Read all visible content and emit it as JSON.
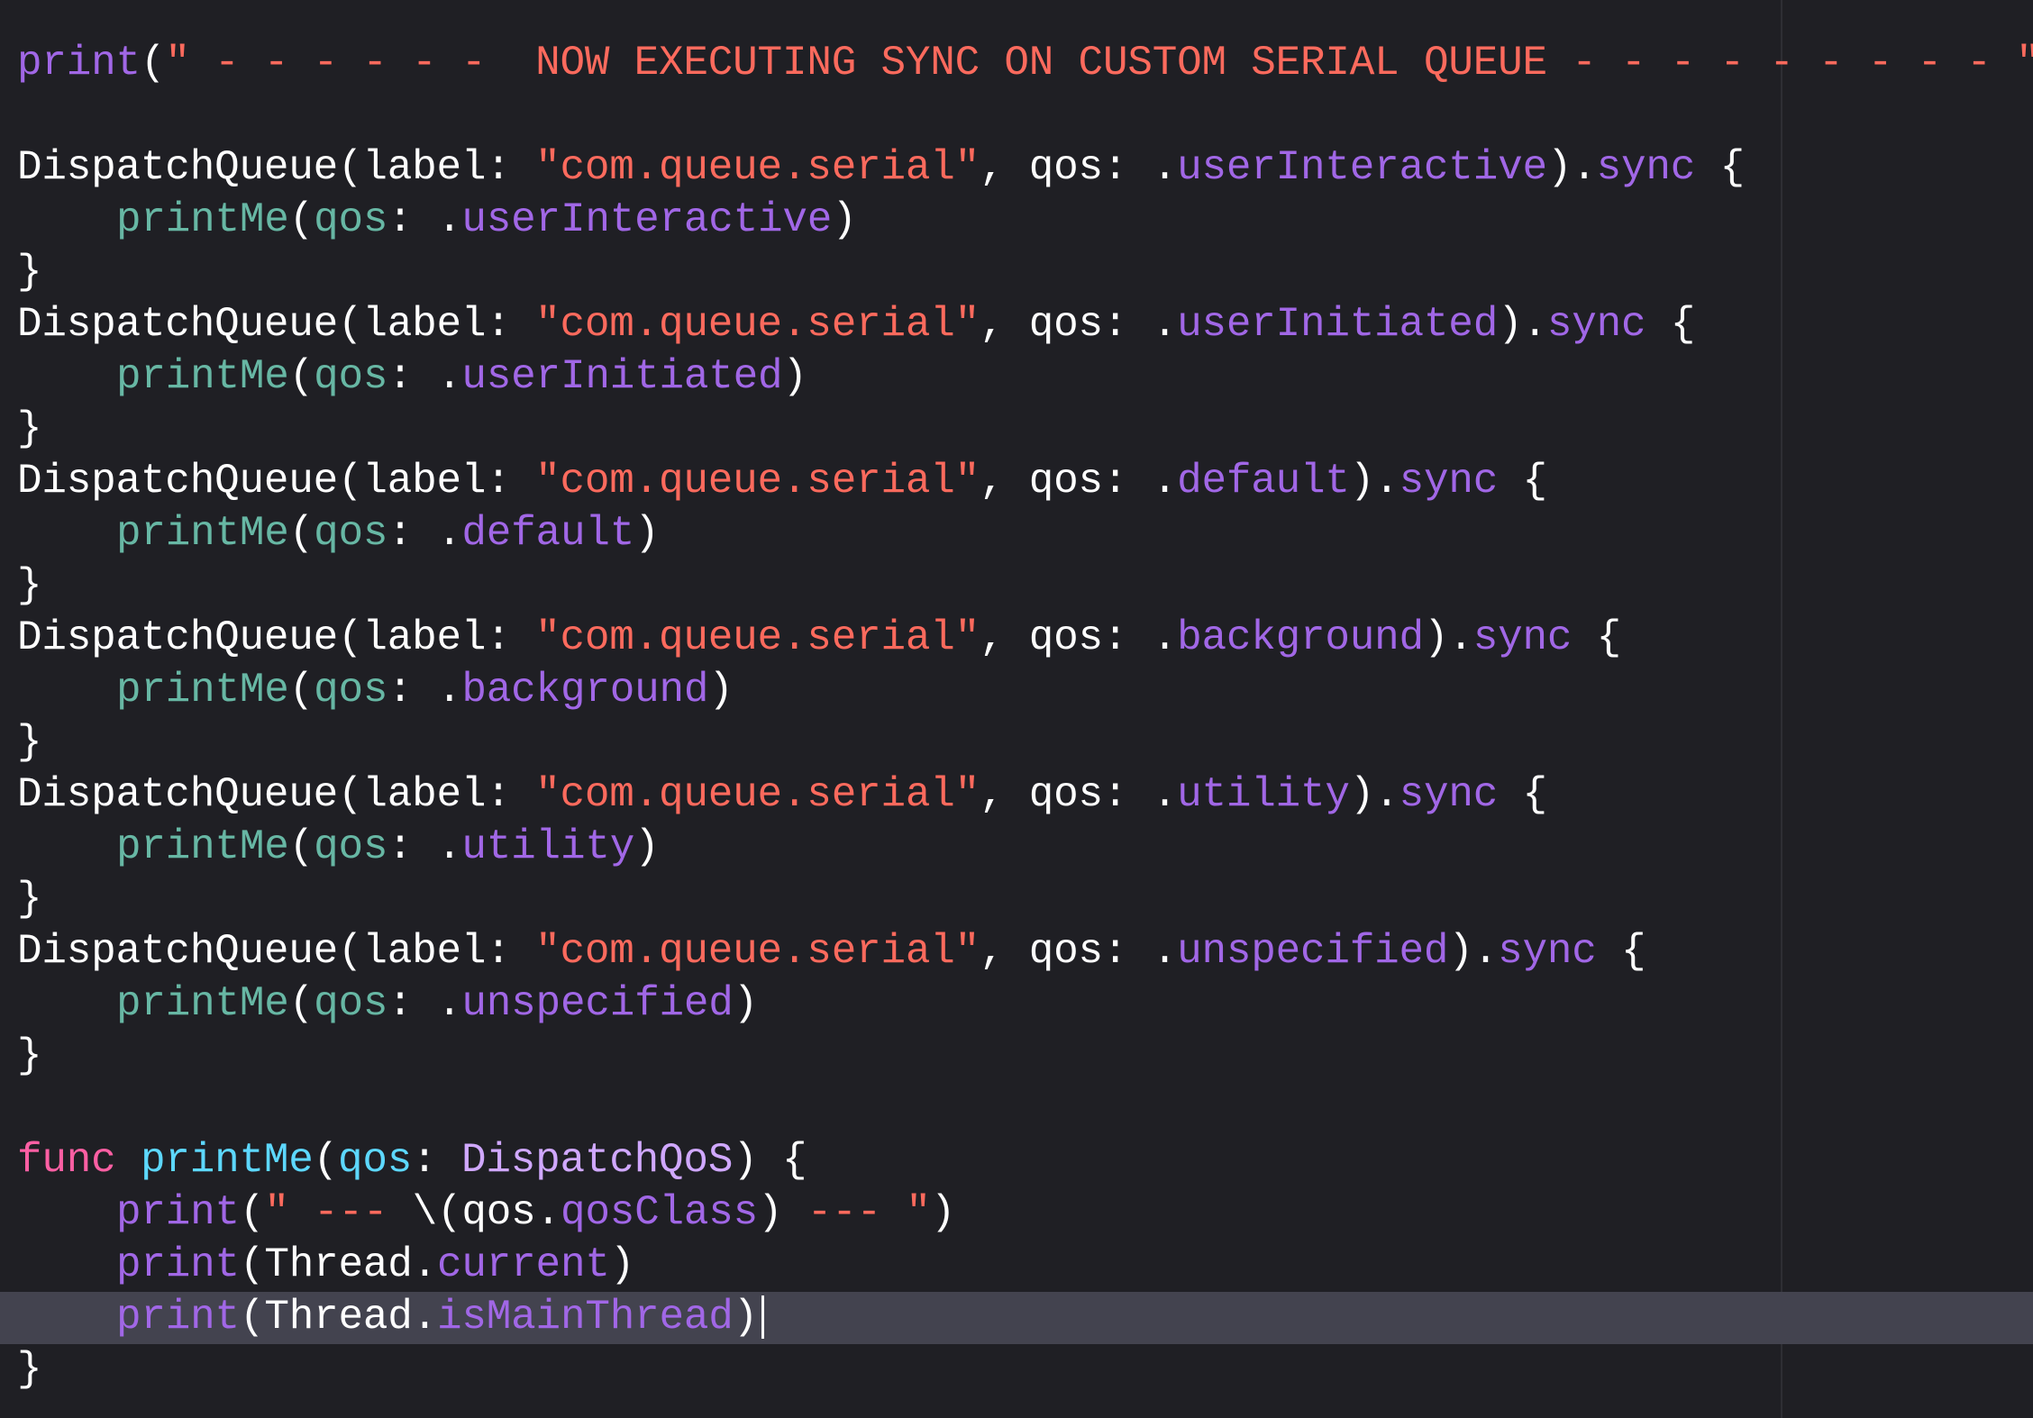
{
  "editor": {
    "theme_colors": {
      "background": "#1f1f24",
      "current_line": "#43434f",
      "plain_text": "#ffffff",
      "string": "#fc6a5d",
      "member": "#a167e6",
      "function_call": "#67b7a4",
      "keyword": "#fc5fa3",
      "declaration": "#5dd8ff",
      "type": "#d0a8ff"
    },
    "current_line_number": 25,
    "lines": [
      {
        "segments": [
          {
            "kind": "member",
            "text": "print"
          },
          {
            "kind": "plain",
            "text": "("
          },
          {
            "kind": "string",
            "text": "\" - - - - - -  NOW EXECUTING SYNC ON CUSTOM SERIAL QUEUE - - - - - - - - - \""
          },
          {
            "kind": "plain",
            "text": ")"
          }
        ]
      },
      {
        "segments": []
      },
      {
        "segments": [
          {
            "kind": "plain",
            "text": "DispatchQueue(label: "
          },
          {
            "kind": "string",
            "text": "\"com.queue.serial\""
          },
          {
            "kind": "plain",
            "text": ", qos: ."
          },
          {
            "kind": "member",
            "text": "userInteractive"
          },
          {
            "kind": "plain",
            "text": ")."
          },
          {
            "kind": "member",
            "text": "sync"
          },
          {
            "kind": "plain",
            "text": " {"
          }
        ]
      },
      {
        "indent": true,
        "segments": [
          {
            "kind": "param",
            "text": "printMe"
          },
          {
            "kind": "plain",
            "text": "("
          },
          {
            "kind": "param",
            "text": "qos"
          },
          {
            "kind": "plain",
            "text": ": ."
          },
          {
            "kind": "member",
            "text": "userInteractive"
          },
          {
            "kind": "plain",
            "text": ")"
          }
        ]
      },
      {
        "segments": [
          {
            "kind": "plain",
            "text": "}"
          }
        ]
      },
      {
        "segments": [
          {
            "kind": "plain",
            "text": "DispatchQueue(label: "
          },
          {
            "kind": "string",
            "text": "\"com.queue.serial\""
          },
          {
            "kind": "plain",
            "text": ", qos: ."
          },
          {
            "kind": "member",
            "text": "userInitiated"
          },
          {
            "kind": "plain",
            "text": ")."
          },
          {
            "kind": "member",
            "text": "sync"
          },
          {
            "kind": "plain",
            "text": " {"
          }
        ]
      },
      {
        "indent": true,
        "segments": [
          {
            "kind": "param",
            "text": "printMe"
          },
          {
            "kind": "plain",
            "text": "("
          },
          {
            "kind": "param",
            "text": "qos"
          },
          {
            "kind": "plain",
            "text": ": ."
          },
          {
            "kind": "member",
            "text": "userInitiated"
          },
          {
            "kind": "plain",
            "text": ")"
          }
        ]
      },
      {
        "segments": [
          {
            "kind": "plain",
            "text": "}"
          }
        ]
      },
      {
        "segments": [
          {
            "kind": "plain",
            "text": "DispatchQueue(label: "
          },
          {
            "kind": "string",
            "text": "\"com.queue.serial\""
          },
          {
            "kind": "plain",
            "text": ", qos: ."
          },
          {
            "kind": "member",
            "text": "default"
          },
          {
            "kind": "plain",
            "text": ")."
          },
          {
            "kind": "member",
            "text": "sync"
          },
          {
            "kind": "plain",
            "text": " {"
          }
        ]
      },
      {
        "indent": true,
        "segments": [
          {
            "kind": "param",
            "text": "printMe"
          },
          {
            "kind": "plain",
            "text": "("
          },
          {
            "kind": "param",
            "text": "qos"
          },
          {
            "kind": "plain",
            "text": ": ."
          },
          {
            "kind": "member",
            "text": "default"
          },
          {
            "kind": "plain",
            "text": ")"
          }
        ]
      },
      {
        "segments": [
          {
            "kind": "plain",
            "text": "}"
          }
        ]
      },
      {
        "segments": [
          {
            "kind": "plain",
            "text": "DispatchQueue(label: "
          },
          {
            "kind": "string",
            "text": "\"com.queue.serial\""
          },
          {
            "kind": "plain",
            "text": ", qos: ."
          },
          {
            "kind": "member",
            "text": "background"
          },
          {
            "kind": "plain",
            "text": ")."
          },
          {
            "kind": "member",
            "text": "sync"
          },
          {
            "kind": "plain",
            "text": " {"
          }
        ]
      },
      {
        "indent": true,
        "segments": [
          {
            "kind": "param",
            "text": "printMe"
          },
          {
            "kind": "plain",
            "text": "("
          },
          {
            "kind": "param",
            "text": "qos"
          },
          {
            "kind": "plain",
            "text": ": ."
          },
          {
            "kind": "member",
            "text": "background"
          },
          {
            "kind": "plain",
            "text": ")"
          }
        ]
      },
      {
        "segments": [
          {
            "kind": "plain",
            "text": "}"
          }
        ]
      },
      {
        "segments": [
          {
            "kind": "plain",
            "text": "DispatchQueue(label: "
          },
          {
            "kind": "string",
            "text": "\"com.queue.serial\""
          },
          {
            "kind": "plain",
            "text": ", qos: ."
          },
          {
            "kind": "member",
            "text": "utility"
          },
          {
            "kind": "plain",
            "text": ")."
          },
          {
            "kind": "member",
            "text": "sync"
          },
          {
            "kind": "plain",
            "text": " {"
          }
        ]
      },
      {
        "indent": true,
        "segments": [
          {
            "kind": "param",
            "text": "printMe"
          },
          {
            "kind": "plain",
            "text": "("
          },
          {
            "kind": "param",
            "text": "qos"
          },
          {
            "kind": "plain",
            "text": ": ."
          },
          {
            "kind": "member",
            "text": "utility"
          },
          {
            "kind": "plain",
            "text": ")"
          }
        ]
      },
      {
        "segments": [
          {
            "kind": "plain",
            "text": "}"
          }
        ]
      },
      {
        "segments": [
          {
            "kind": "plain",
            "text": "DispatchQueue(label: "
          },
          {
            "kind": "string",
            "text": "\"com.queue.serial\""
          },
          {
            "kind": "plain",
            "text": ", qos: ."
          },
          {
            "kind": "member",
            "text": "unspecified"
          },
          {
            "kind": "plain",
            "text": ")."
          },
          {
            "kind": "member",
            "text": "sync"
          },
          {
            "kind": "plain",
            "text": " {"
          }
        ]
      },
      {
        "indent": true,
        "segments": [
          {
            "kind": "param",
            "text": "printMe"
          },
          {
            "kind": "plain",
            "text": "("
          },
          {
            "kind": "param",
            "text": "qos"
          },
          {
            "kind": "plain",
            "text": ": ."
          },
          {
            "kind": "member",
            "text": "unspecified"
          },
          {
            "kind": "plain",
            "text": ")"
          }
        ]
      },
      {
        "segments": [
          {
            "kind": "plain",
            "text": "}"
          }
        ]
      },
      {
        "segments": []
      },
      {
        "segments": [
          {
            "kind": "keyword",
            "text": "func"
          },
          {
            "kind": "plain",
            "text": " "
          },
          {
            "kind": "func-decl",
            "text": "printMe"
          },
          {
            "kind": "plain",
            "text": "("
          },
          {
            "kind": "func-decl",
            "text": "qos"
          },
          {
            "kind": "plain",
            "text": ": "
          },
          {
            "kind": "type-name",
            "text": "DispatchQoS"
          },
          {
            "kind": "plain",
            "text": ") {"
          }
        ]
      },
      {
        "indent": true,
        "segments": [
          {
            "kind": "member",
            "text": "print"
          },
          {
            "kind": "plain",
            "text": "("
          },
          {
            "kind": "string",
            "text": "\" --- "
          },
          {
            "kind": "plain",
            "text": "\\(qos."
          },
          {
            "kind": "member",
            "text": "qosClass"
          },
          {
            "kind": "plain",
            "text": ")"
          },
          {
            "kind": "string",
            "text": " --- \""
          },
          {
            "kind": "plain",
            "text": ")"
          }
        ]
      },
      {
        "indent": true,
        "segments": [
          {
            "kind": "member",
            "text": "print"
          },
          {
            "kind": "plain",
            "text": "(Thread."
          },
          {
            "kind": "member",
            "text": "current"
          },
          {
            "kind": "plain",
            "text": ")"
          }
        ]
      },
      {
        "indent": true,
        "cursor": true,
        "segments": [
          {
            "kind": "member",
            "text": "print"
          },
          {
            "kind": "plain",
            "text": "(Thread."
          },
          {
            "kind": "member",
            "text": "isMainThread"
          },
          {
            "kind": "plain",
            "text": ")"
          }
        ]
      },
      {
        "segments": [
          {
            "kind": "plain",
            "text": "}"
          }
        ]
      }
    ]
  }
}
